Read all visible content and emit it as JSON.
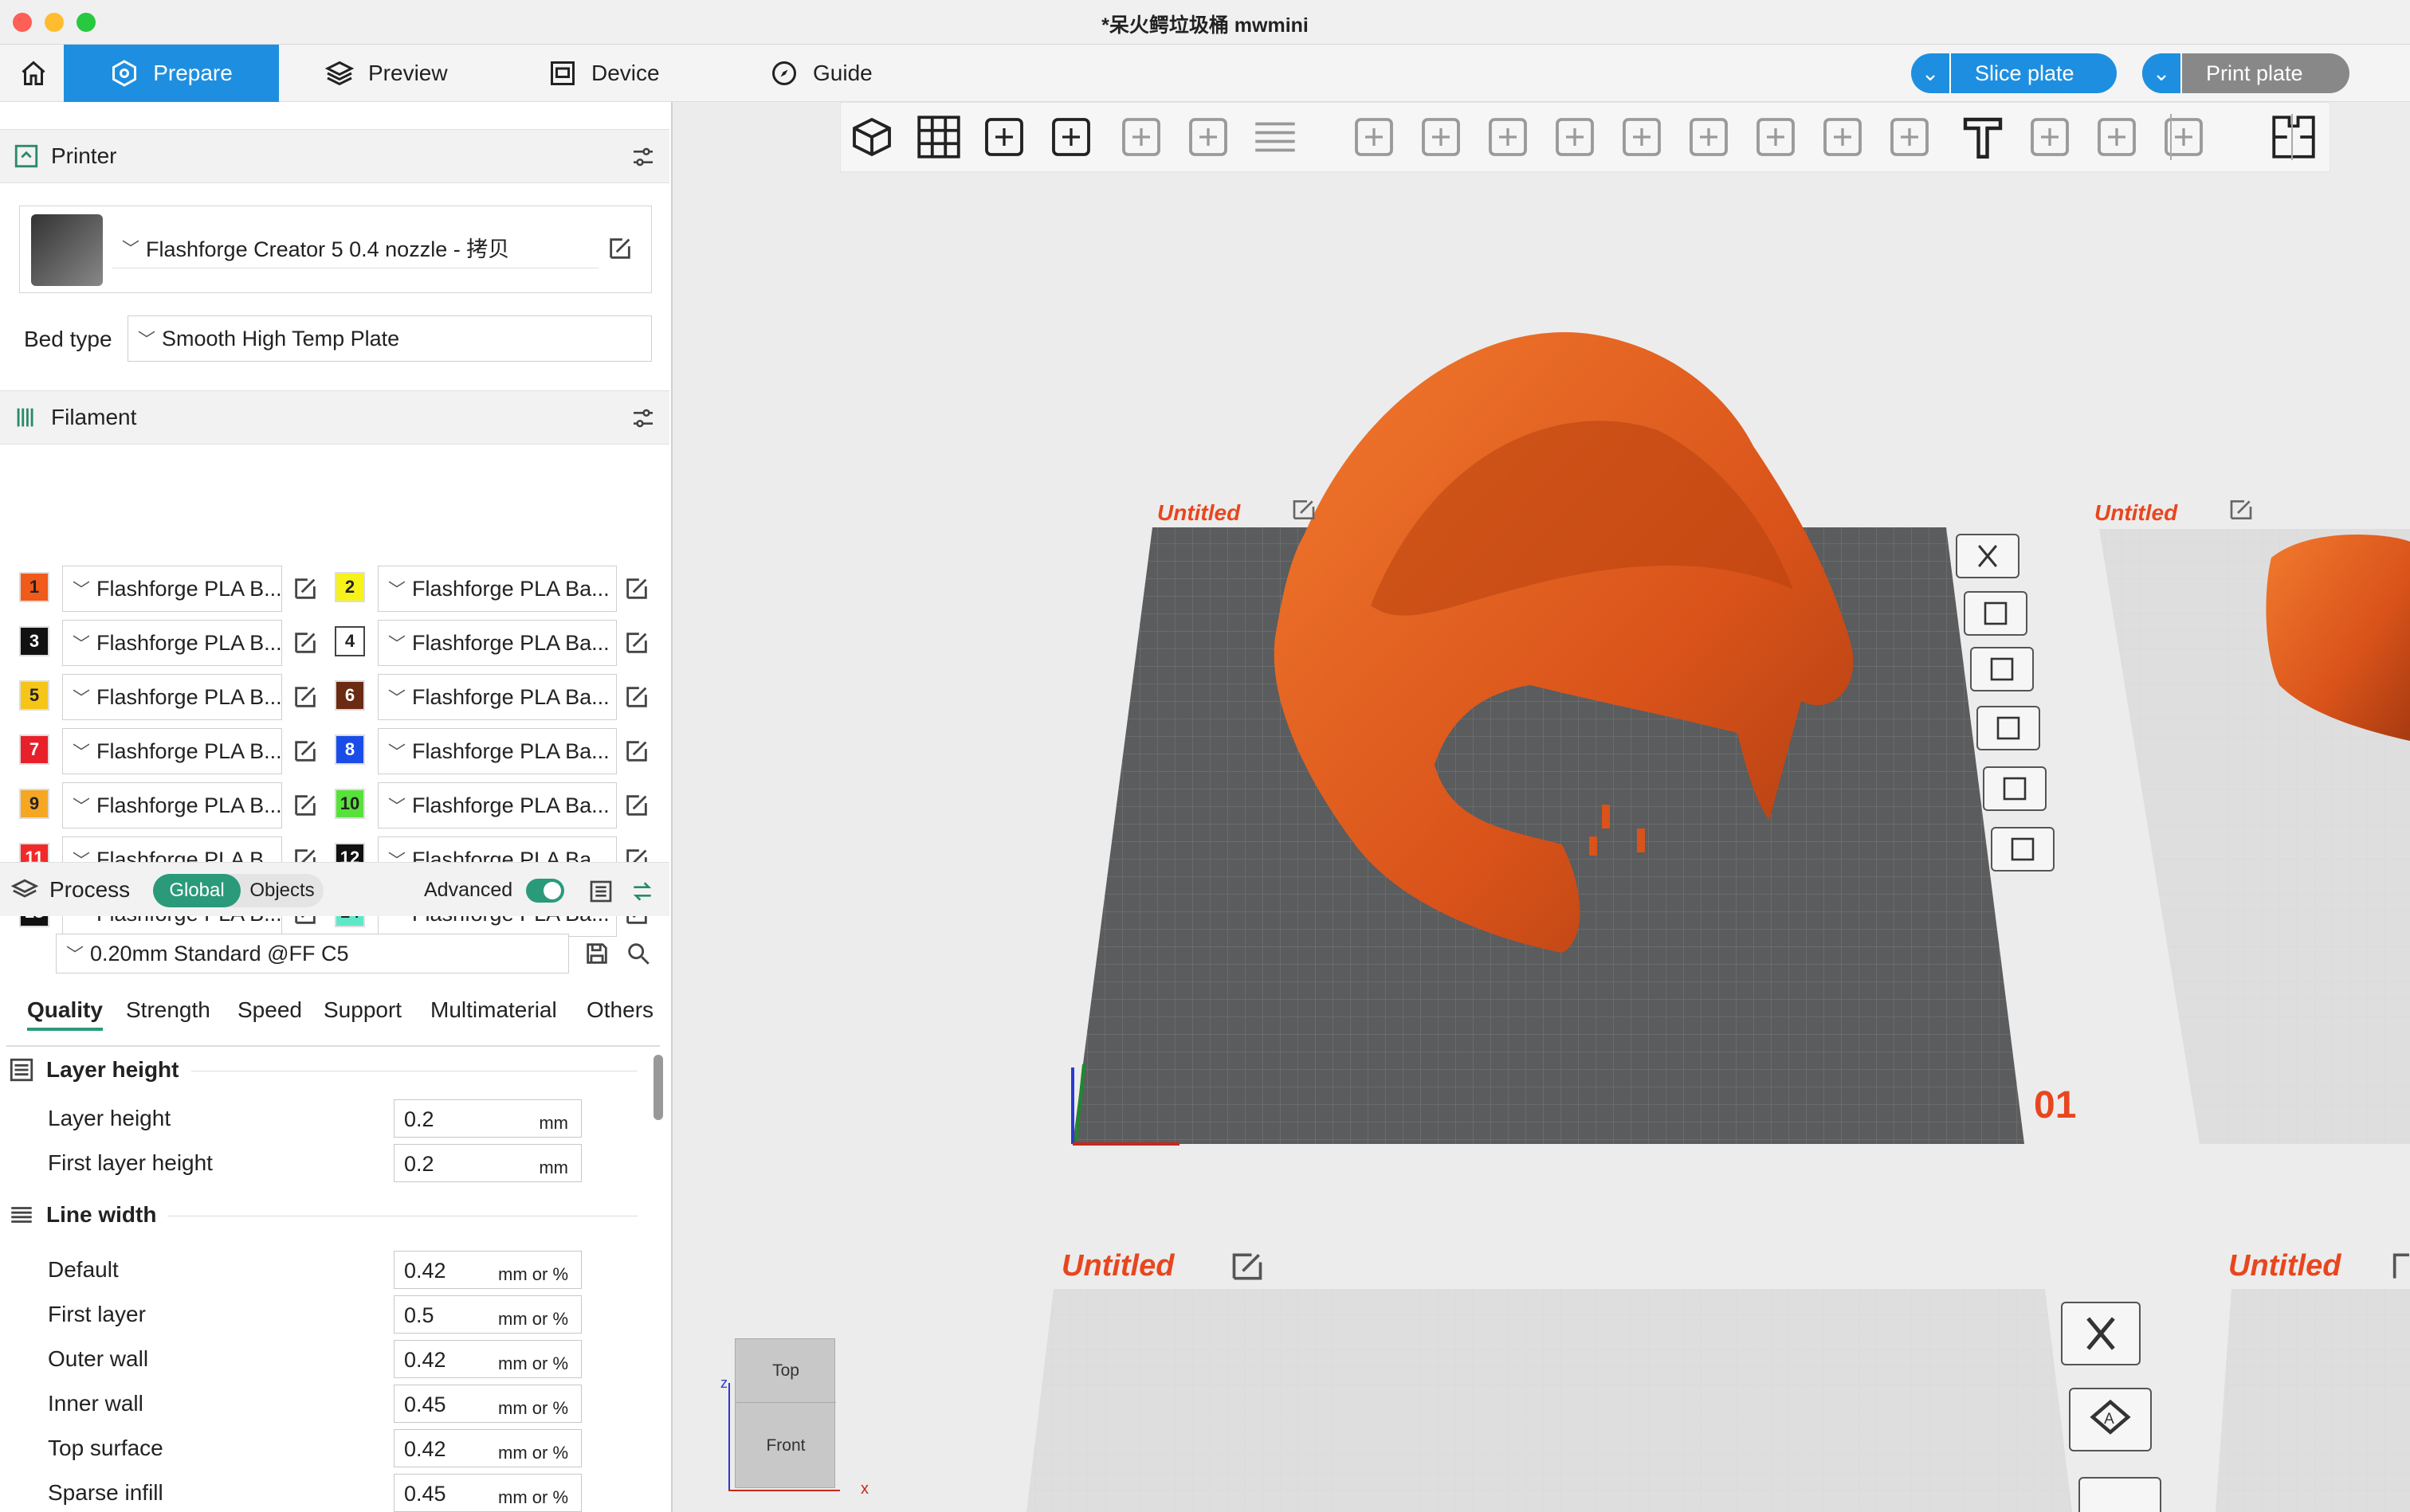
{
  "window": {
    "title": "*呆火鳄垃圾桶 mwmini"
  },
  "menubar": {
    "home_icon": "home-icon",
    "tabs": [
      {
        "label": "Prepare",
        "icon": "prepare-icon"
      },
      {
        "label": "Preview",
        "icon": "layers-icon"
      },
      {
        "label": "Device",
        "icon": "device-icon"
      },
      {
        "label": "Guide",
        "icon": "compass-icon"
      }
    ],
    "slice_label": "Slice plate",
    "print_label": "Print plate"
  },
  "printer": {
    "header": "Printer",
    "name": "Flashforge Creator 5 0.4 nozzle - 拷贝",
    "bed_type_label": "Bed type",
    "bed_type": "Smooth High Temp Plate"
  },
  "filament": {
    "header": "Filament",
    "items": [
      {
        "num": "1",
        "name": "Flashforge PLA B...",
        "color": "#f05a1a"
      },
      {
        "num": "2",
        "name": "Flashforge PLA Ba...",
        "color": "#f7f21a"
      },
      {
        "num": "3",
        "name": "Flashforge PLA B...",
        "color": "#111111"
      },
      {
        "num": "4",
        "name": "Flashforge PLA Ba...",
        "color": "#ffffff"
      },
      {
        "num": "5",
        "name": "Flashforge PLA B...",
        "color": "#f5c518"
      },
      {
        "num": "6",
        "name": "Flashforge PLA Ba...",
        "color": "#6b2a12"
      },
      {
        "num": "7",
        "name": "Flashforge PLA B...",
        "color": "#e8202a"
      },
      {
        "num": "8",
        "name": "Flashforge PLA Ba...",
        "color": "#1a4de8"
      },
      {
        "num": "9",
        "name": "Flashforge PLA B...",
        "color": "#f5a623"
      },
      {
        "num": "10",
        "name": "Flashforge PLA Ba...",
        "color": "#57e23a"
      },
      {
        "num": "11",
        "name": "Flashforge PLA B...",
        "color": "#f02a2a"
      },
      {
        "num": "12",
        "name": "Flashforge PLA Ba...",
        "color": "#111111"
      },
      {
        "num": "13",
        "name": "Flashforge PLA B...",
        "color": "#111111"
      },
      {
        "num": "14",
        "name": "Flashforge PLA Ba...",
        "color": "#5ee8c8"
      }
    ]
  },
  "process": {
    "header": "Process",
    "toggle_global": "Global",
    "toggle_objects": "Objects",
    "advanced_label": "Advanced",
    "advanced_on": true,
    "preset": "0.20mm Standard @FF C5",
    "tabs": [
      "Quality",
      "Strength",
      "Speed",
      "Support",
      "Multimaterial",
      "Others"
    ],
    "active_tab": "Quality",
    "groups": [
      {
        "title": "Layer height",
        "rows": [
          {
            "label": "Layer height",
            "value": "0.2",
            "unit": "mm"
          },
          {
            "label": "First layer height",
            "value": "0.2",
            "unit": "mm"
          }
        ]
      },
      {
        "title": "Line width",
        "rows": [
          {
            "label": "Default",
            "value": "0.42",
            "unit": "mm or %"
          },
          {
            "label": "First layer",
            "value": "0.5",
            "unit": "mm or %"
          },
          {
            "label": "Outer wall",
            "value": "0.42",
            "unit": "mm or %"
          },
          {
            "label": "Inner wall",
            "value": "0.45",
            "unit": "mm or %"
          },
          {
            "label": "Top surface",
            "value": "0.42",
            "unit": "mm or %"
          },
          {
            "label": "Sparse infill",
            "value": "0.45",
            "unit": "mm or %"
          }
        ]
      }
    ]
  },
  "viewport": {
    "plates": [
      {
        "name": "Untitled"
      },
      {
        "name": "Untitled"
      },
      {
        "name": "Untitled"
      },
      {
        "name": "Untitled"
      }
    ],
    "plate_number": "01",
    "view_cube": {
      "top": "Top",
      "front": "Front",
      "axis_z": "z",
      "axis_x": "x"
    },
    "toolbar_icons": [
      "add-cube-icon",
      "arrange-grid-icon",
      "auto-orient-icon",
      "split-plate-icon",
      "split-objects-icon",
      "split-parts-icon",
      "layers-list-icon",
      "move-icon",
      "rotate-icon",
      "scale-icon",
      "lay-on-face-icon",
      "cut-icon",
      "boolean-icon",
      "support-paint-icon",
      "seam-paint-icon",
      "variable-height-icon",
      "text-icon",
      "measure-icon",
      "assembly-icon",
      "fuzzy-skin-icon",
      "puzzle-icon"
    ],
    "side_icons": [
      "close-icon",
      "auto-orient-icon",
      "arrange-icon",
      "lock-icon",
      "plate-settings-icon",
      "move-top-icon"
    ]
  },
  "colors": {
    "accent": "#1e8fe0",
    "model": "#e8581c",
    "plate_label": "#e8461f"
  }
}
